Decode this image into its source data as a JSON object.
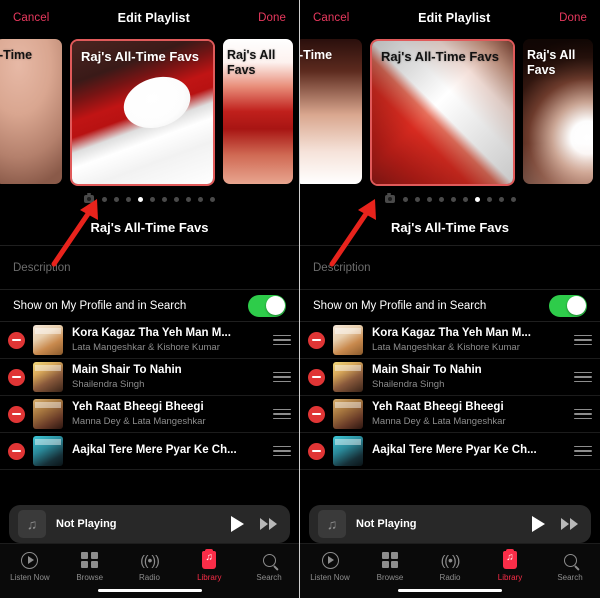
{
  "meta": {
    "accent_red": "#fa2d48",
    "toggle_green": "#2ecc4a",
    "background": "#000000"
  },
  "navbar": {
    "cancel": "Cancel",
    "title": "Edit Playlist",
    "done": "Done"
  },
  "playlist": {
    "name": "Raj's All-Time Favs",
    "description_placeholder": "Description",
    "share_label": "Show on My Profile and in Search",
    "share_enabled": true
  },
  "artwork": {
    "card_title": "Raj's All-Time Favs",
    "side_title_left": "-Time",
    "side_title_right": "Raj's All Favs",
    "dots_total": 10,
    "camera_icon": "camera-icon"
  },
  "panels": [
    {
      "id": "left",
      "selected_dot_index": 3,
      "main_art_style": "vinyl-record-red",
      "left_art_style": "peach-gradient",
      "right_art_style": "white-red-fade"
    },
    {
      "id": "right",
      "selected_dot_index": 6,
      "main_art_style": "diagonal-split-red",
      "left_art_style": "vertical-stripes",
      "right_art_style": "radial-curve"
    }
  ],
  "songs": [
    {
      "title": "Kora Kagaz Tha Yeh Man M...",
      "artist": "Lata Mangeshkar & Kishore Kumar"
    },
    {
      "title": "Main Shair To Nahin",
      "artist": "Shailendra Singh"
    },
    {
      "title": "Yeh Raat Bheegi Bheegi",
      "artist": "Manna Dey & Lata Mangeshkar"
    },
    {
      "title": "Aajkal Tere Mere Pyar Ke Ch...",
      "artist": ""
    }
  ],
  "miniplayer": {
    "status": "Not Playing",
    "artwork_icon": "music-note-icon",
    "play_icon": "play-icon",
    "forward_icon": "fast-forward-icon"
  },
  "tabbar": {
    "items": [
      {
        "label": "Listen Now",
        "icon": "play-circle-icon",
        "active": false
      },
      {
        "label": "Browse",
        "icon": "grid-icon",
        "active": false
      },
      {
        "label": "Radio",
        "icon": "broadcast-icon",
        "active": false
      },
      {
        "label": "Library",
        "icon": "library-icon",
        "active": true
      },
      {
        "label": "Search",
        "icon": "search-icon",
        "active": false
      }
    ]
  },
  "annotations": [
    {
      "name": "arrow-to-camera-icon-left",
      "color": "#e8231c"
    },
    {
      "name": "arrow-to-camera-icon-right",
      "color": "#e8231c"
    }
  ]
}
